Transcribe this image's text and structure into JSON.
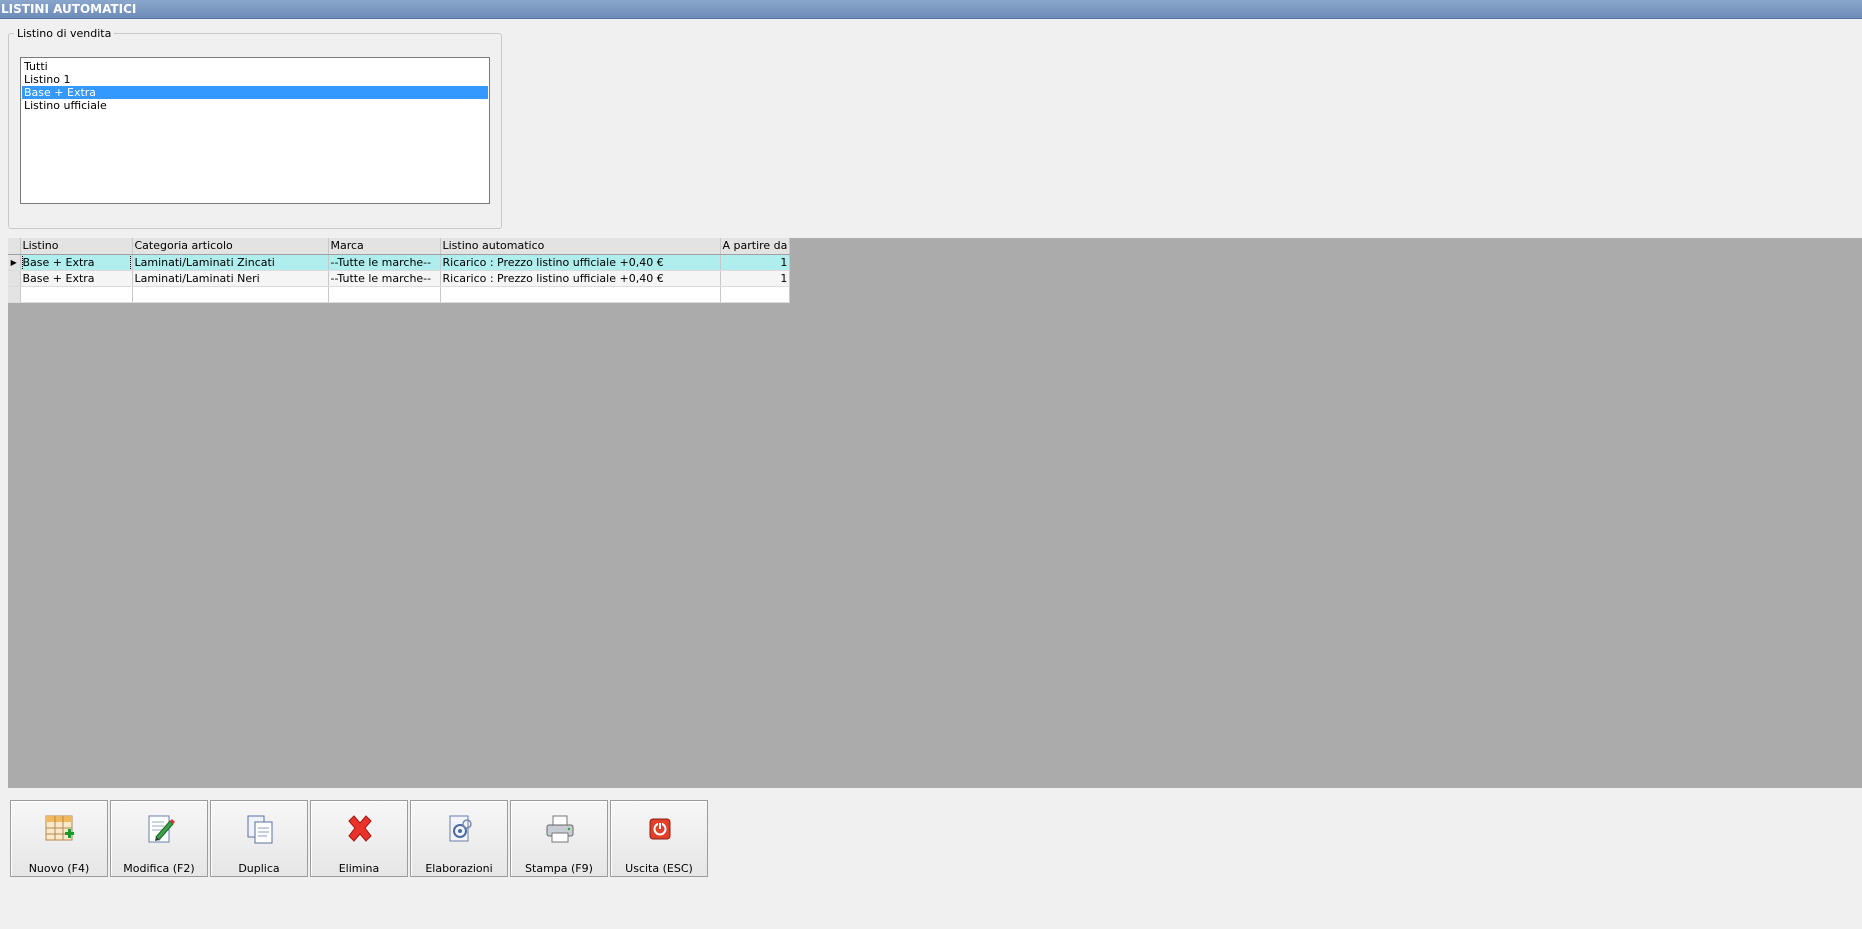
{
  "window": {
    "title": "LISTINI AUTOMATICI"
  },
  "filter": {
    "group_label": "Listino di vendita",
    "items": [
      {
        "label": "Tutti",
        "selected": false
      },
      {
        "label": "Listino 1",
        "selected": false
      },
      {
        "label": "Base + Extra",
        "selected": true
      },
      {
        "label": "Listino ufficiale",
        "selected": false
      }
    ]
  },
  "grid": {
    "columns": [
      "Listino",
      "Categoria articolo",
      "Marca",
      "Listino automatico",
      "A partire da"
    ],
    "rows": [
      [
        "Base + Extra",
        "Laminati/Laminati Zincati",
        "--Tutte le marche--",
        "Ricarico : Prezzo listino ufficiale +0,40 €",
        "1"
      ],
      [
        "Base + Extra",
        "Laminati/Laminati Neri",
        "--Tutte le marche--",
        "Ricarico : Prezzo listino ufficiale +0,40 €",
        "1"
      ],
      [
        "",
        "",
        "",
        "",
        ""
      ]
    ],
    "current_row_marker": "▶"
  },
  "toolbar": {
    "buttons": [
      {
        "label": "Nuovo (F4)",
        "icon": "grid-add-icon"
      },
      {
        "label": "Modifica (F2)",
        "icon": "edit-document-icon"
      },
      {
        "label": "Duplica",
        "icon": "copy-documents-icon"
      },
      {
        "label": "Elimina",
        "icon": "delete-x-icon"
      },
      {
        "label": "Elaborazioni",
        "icon": "process-gears-icon"
      },
      {
        "label": "Stampa (F9)",
        "icon": "printer-icon"
      },
      {
        "label": "Uscita (ESC)",
        "icon": "exit-power-icon"
      }
    ]
  },
  "colors": {
    "title_bar": "#7d9bc4",
    "selection": "#3399ff",
    "active_row": "#b0eeee",
    "grid_background": "#ababab"
  }
}
